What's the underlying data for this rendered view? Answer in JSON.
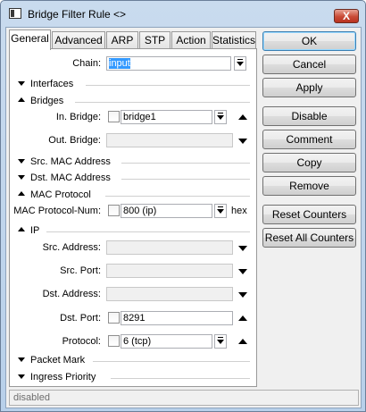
{
  "window": {
    "title": "Bridge Filter Rule <>",
    "close_label": "X"
  },
  "tabs": [
    "General",
    "Advanced",
    "ARP",
    "STP",
    "Action",
    "Statistics"
  ],
  "general": {
    "chain_label": "Chain:",
    "chain_value": "input",
    "interfaces_label": "Interfaces",
    "bridges_label": "Bridges",
    "in_bridge_label": "In. Bridge:",
    "in_bridge_value": "bridge1",
    "out_bridge_label": "Out. Bridge:",
    "src_mac_label": "Src. MAC Address",
    "dst_mac_label": "Dst. MAC Address",
    "mac_protocol_label": "MAC Protocol",
    "mac_protocol_num_label": "MAC Protocol-Num:",
    "mac_protocol_num_value": "800 (ip)",
    "mac_protocol_num_unit": "hex",
    "ip_label": "IP",
    "src_address_label": "Src. Address:",
    "src_port_label": "Src. Port:",
    "dst_address_label": "Dst. Address:",
    "dst_port_label": "Dst. Port:",
    "dst_port_value": "8291",
    "protocol_label": "Protocol:",
    "protocol_value": "6 (tcp)",
    "packet_mark_label": "Packet Mark",
    "ingress_priority_label": "Ingress Priority"
  },
  "buttons": {
    "ok": "OK",
    "cancel": "Cancel",
    "apply": "Apply",
    "disable": "Disable",
    "comment": "Comment",
    "copy": "Copy",
    "remove": "Remove",
    "reset_counters": "Reset Counters",
    "reset_all_counters": "Reset All Counters"
  },
  "status": "disabled"
}
